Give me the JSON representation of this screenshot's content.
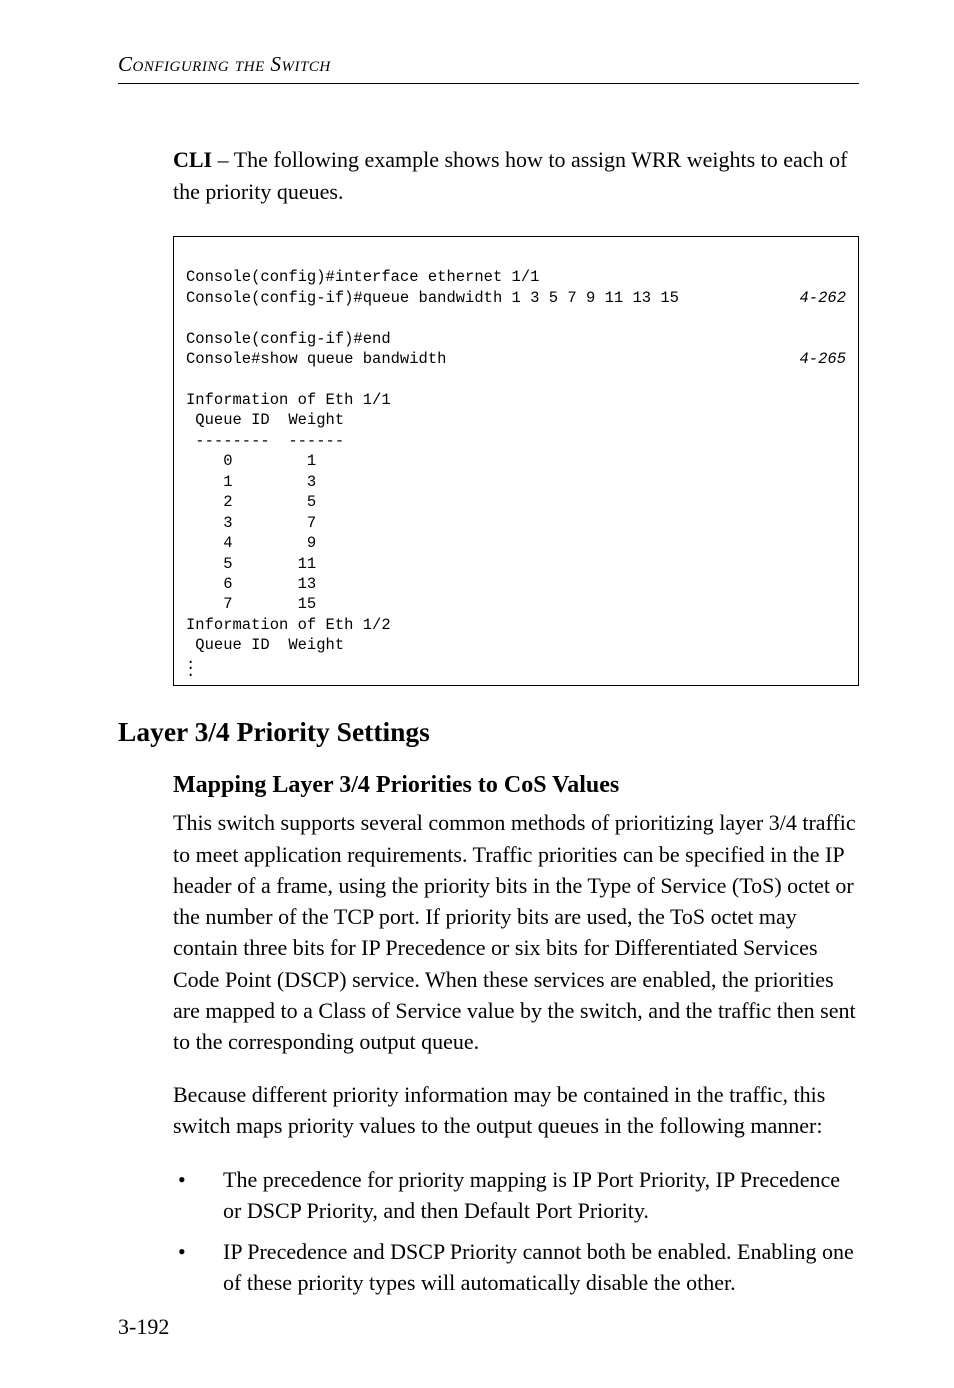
{
  "running_head": "Configuring the Switch",
  "lead": {
    "strong": "CLI",
    "rest": " – The following example shows how to assign WRR weights to each of the priority queues."
  },
  "code": {
    "l1": "Console(config)#interface ethernet 1/1",
    "l2_left": "Console(config-if)#queue bandwidth 1 3 5 7 9 11 13 15",
    "l2_right": "4-262",
    "l3": "Console(config-if)#end",
    "l4_left": "Console#show queue bandwidth",
    "l4_right": "4-265",
    "l5": "Information of Eth 1/1",
    "l6": " Queue ID  Weight",
    "l7": " --------  ------",
    "l8": "    0        1",
    "l9": "    1        3",
    "l10": "    2        5",
    "l11": "    3        7",
    "l12": "    4        9",
    "l13": "    5       11",
    "l14": "    6       13",
    "l15": "    7       15",
    "l16": "Information of Eth 1/2",
    "l17": " Queue ID  Weight",
    "dot": "."
  },
  "section_title": "Layer 3/4 Priority Settings",
  "subsection_title": "Mapping Layer 3/4 Priorities to CoS Values",
  "body1": "This switch supports several common methods of prioritizing layer 3/4 traffic to meet application requirements. Traffic priorities can be specified in the IP header of a frame, using the priority bits in the Type of Service (ToS) octet or the number of the TCP port. If priority bits are used, the ToS octet may contain three bits for IP Precedence or six bits for Differentiated Services Code Point (DSCP) service. When these services are enabled, the priorities are mapped to a Class of Service value by the switch, and the traffic then sent to the corresponding output queue.",
  "body2": "Because different priority information may be contained in the traffic, this switch maps priority values to the output queues in the following manner:",
  "bullets": [
    "The precedence for priority mapping is IP Port Priority, IP Precedence or DSCP Priority, and then Default Port Priority.",
    "IP Precedence and DSCP Priority cannot both be enabled. Enabling one of these priority types will automatically disable the other."
  ],
  "bullet_char": "•",
  "page_number": "3-192",
  "chart_data": {
    "type": "table",
    "title": "Queue bandwidth weights (Eth 1/1)",
    "columns": [
      "Queue ID",
      "Weight"
    ],
    "rows": [
      [
        0,
        1
      ],
      [
        1,
        3
      ],
      [
        2,
        5
      ],
      [
        3,
        7
      ],
      [
        4,
        9
      ],
      [
        5,
        11
      ],
      [
        6,
        13
      ],
      [
        7,
        15
      ]
    ]
  }
}
